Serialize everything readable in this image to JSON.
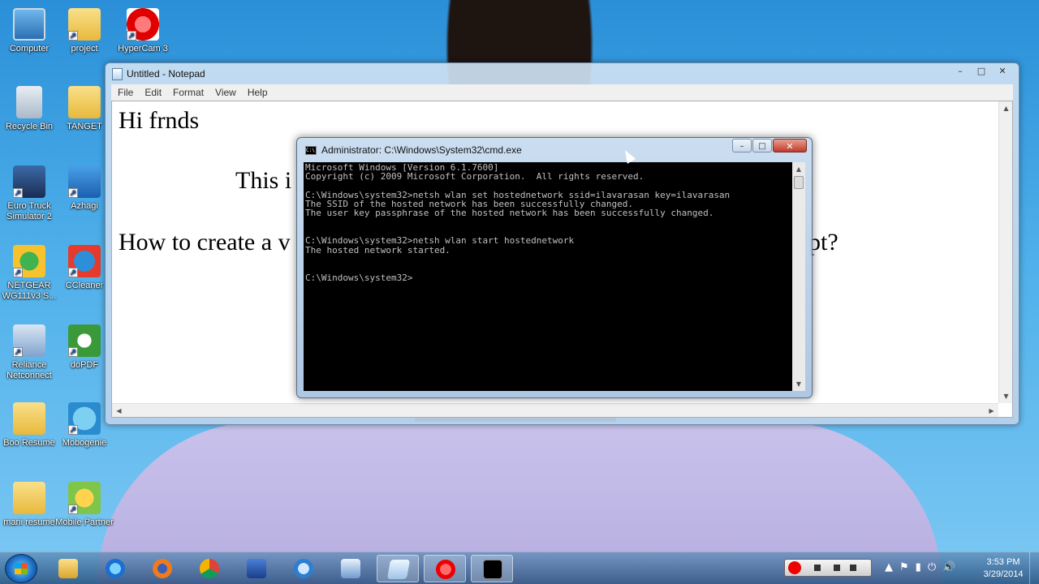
{
  "desktop": {
    "icons": [
      {
        "label": "Computer",
        "icon": "computer-icon"
      },
      {
        "label": "project",
        "icon": "folder-icon"
      },
      {
        "label": "HyperCam 3",
        "icon": "hypercam-icon"
      },
      {
        "label": "Recycle Bin",
        "icon": "recycle-bin-icon"
      },
      {
        "label": "TANGET",
        "icon": "folder-icon"
      },
      {
        "label": "Euro Truck Simulator 2",
        "icon": "truck-icon"
      },
      {
        "label": "Azhagi",
        "icon": "azhagi-icon"
      },
      {
        "label": "NETGEAR WG111v3 S...",
        "icon": "netgear-icon"
      },
      {
        "label": "CCleaner",
        "icon": "ccleaner-icon"
      },
      {
        "label": "Reliance Netconnect",
        "icon": "reliance-icon"
      },
      {
        "label": "doPDF",
        "icon": "dopdf-icon"
      },
      {
        "label": "Boo Resume",
        "icon": "folder-icon"
      },
      {
        "label": "Mobogenie",
        "icon": "mobogenie-icon"
      },
      {
        "label": "mani resume",
        "icon": "folder-icon"
      },
      {
        "label": "Mobile Partner",
        "icon": "mobile-partner-icon"
      }
    ]
  },
  "notepad": {
    "title": "Untitled - Notepad",
    "menu": [
      "File",
      "Edit",
      "Format",
      "View",
      "Help"
    ],
    "lines": {
      "line1": "Hi frnds",
      "line2": "This i",
      "line3_left": "How to create a v",
      "line3_right": "pt?"
    }
  },
  "cmd": {
    "title": "Administrator: C:\\Windows\\System32\\cmd.exe",
    "icon_text": "C:\\",
    "lines": [
      "Microsoft Windows [Version 6.1.7600]",
      "Copyright (c) 2009 Microsoft Corporation.  All rights reserved.",
      "",
      "C:\\Windows\\system32>netsh wlan set hostednetwork ssid=ilavarasan key=ilavarasan",
      "The SSID of the hosted network has been successfully changed.",
      "The user key passphrase of the hosted network has been successfully changed.",
      "",
      "",
      "C:\\Windows\\system32>netsh wlan start hostednetwork",
      "The hosted network started.",
      "",
      "",
      "C:\\Windows\\system32>"
    ]
  },
  "window_controls": {
    "minimize": "–",
    "maximize": "□",
    "close": "✕"
  },
  "taskbar": {
    "apps": [
      "windows-explorer",
      "internet-explorer",
      "firefox",
      "chrome",
      "azhagi",
      "network",
      "mail",
      "notepad",
      "hypercam",
      "cmd"
    ],
    "clock": {
      "time": "3:53 PM",
      "date": "3/29/2014"
    }
  }
}
